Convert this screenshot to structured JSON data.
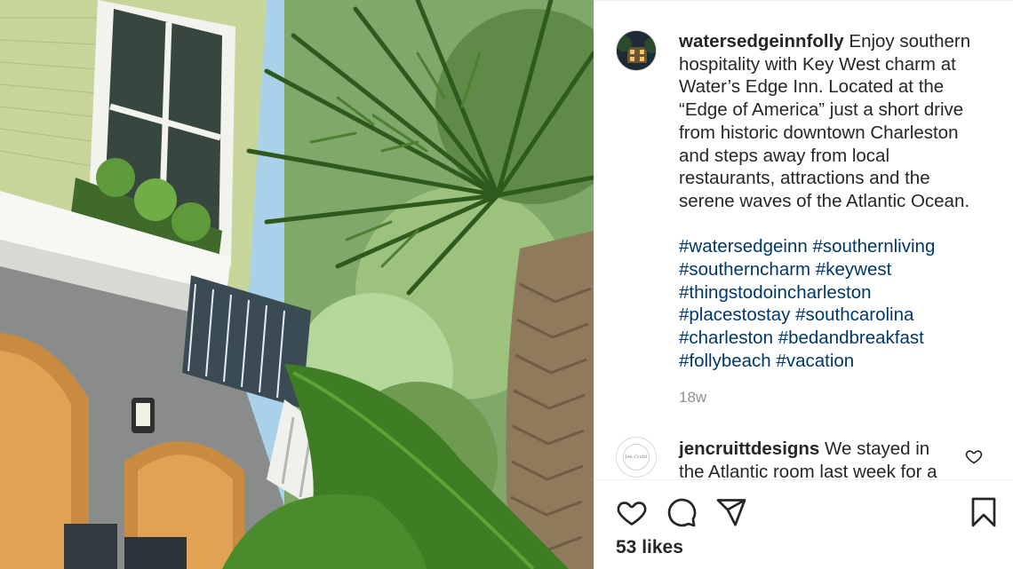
{
  "post": {
    "username": "watersedgeinnfolly",
    "caption": "Enjoy southern hospitality with Key West charm at Water’s Edge Inn. Located at the “Edge of America” just a short drive from historic downtown Charleston and steps away from local restaurants, attractions and the serene waves of the Atlantic Ocean.",
    "hashtags": [
      "#watersedgeinn",
      "#southernliving",
      "#southerncharm",
      "#keywest",
      "#thingstodoincharleston",
      "#placestostay",
      "#southcarolina",
      "#charleston",
      "#bedandbreakfast",
      "#follybeach",
      "#vacation"
    ],
    "time_ago": "18w",
    "likes": "53 likes"
  },
  "comment": {
    "username": "jencruittdesigns",
    "text": "We stayed in the Atlantic room last week for a",
    "avatar_text": "Jen Cruitt"
  },
  "icons": {
    "like": "heart-icon",
    "comment": "comment-bubble-icon",
    "share": "paper-plane-icon",
    "save": "bookmark-icon",
    "comment_like": "small-heart-icon"
  },
  "colors": {
    "text": "#262626",
    "hashtag": "#00376b",
    "muted": "#8e8e8e",
    "divider": "#efefef"
  }
}
